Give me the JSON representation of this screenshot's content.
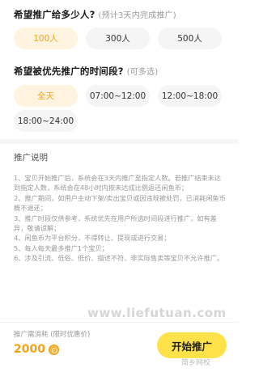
{
  "count_section": {
    "title": "希望推广给多少人?",
    "hint": "(预计3天内完成推广)",
    "options": [
      "100人",
      "300人",
      "500人"
    ],
    "selected": "100人"
  },
  "time_section": {
    "title": "希望被优先推广的时间段?",
    "hint": "(可多选)",
    "options": [
      "全天",
      "07:00~12:00",
      "12:00~18:00",
      "18:00~24:00"
    ],
    "selected": "全天"
  },
  "description": {
    "title": "推广说明",
    "items": [
      "1、宝贝开始推广后，系统会在3天内推广至指定人数。若推广结束未达到指定人数，系统会在48小时内按未达成比例返还闲鱼币；",
      "2、推广期间，如用户主动下架/卖出宝贝或因违规被处罚，已消耗闲鱼币概不退还；",
      "3、推广时段仅供参考，系统优先在用户所选时间段进行推广，如有差异，敬请谅解；",
      "4、闲鱼币为平台积分，不得转让、提现或进行交易；",
      "5、每人每天最多推广1个宝贝；",
      "6、涉及引流、低俗、低价、描述不符、非实际售卖等宝贝不允许推广。"
    ]
  },
  "footer": {
    "cost_label": "推广需消耗  (限时优惠价)",
    "cost_value": "2000",
    "start_label": "开始推广"
  },
  "watermark": "www.liefutuan.com",
  "logo_text": "简乡网校",
  "colors": {
    "accent": "#f2a316",
    "active_bg": "#fff4df",
    "button_bg": "#ffe14a"
  }
}
